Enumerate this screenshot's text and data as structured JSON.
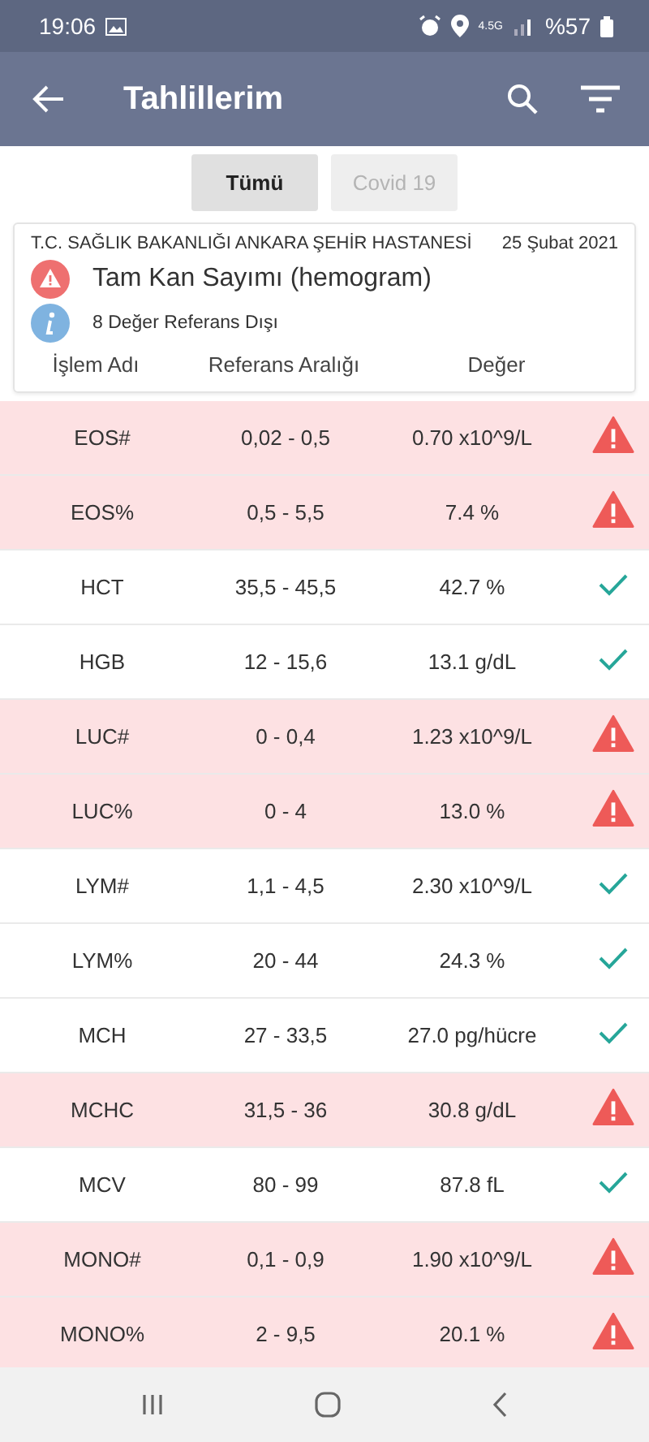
{
  "status_bar": {
    "time": "19:06",
    "network": "4.5G",
    "battery": "%57"
  },
  "app_bar": {
    "title": "Tahlillerim"
  },
  "tabs": [
    {
      "label": "Tümü",
      "selected": true
    },
    {
      "label": "Covid 19",
      "selected": false
    }
  ],
  "report": {
    "hospital": "T.C. SAĞLIK BAKANLIĞI ANKARA ŞEHİR HASTANESİ",
    "date": "25 Şubat 2021",
    "title": "Tam Kan Sayımı (hemogram)",
    "note": "8 Değer Referans Dışı",
    "columns": [
      "İşlem Adı",
      "Referans Aralığı",
      "Değer"
    ]
  },
  "rows": [
    {
      "name": "EOS#",
      "range": "0,02 - 0,5",
      "value": "0.70 x10^9/L",
      "abnormal": true
    },
    {
      "name": "EOS%",
      "range": "0,5 - 5,5",
      "value": "7.4 %",
      "abnormal": true
    },
    {
      "name": "HCT",
      "range": "35,5 - 45,5",
      "value": "42.7 %",
      "abnormal": false
    },
    {
      "name": "HGB",
      "range": "12 - 15,6",
      "value": "13.1 g/dL",
      "abnormal": false
    },
    {
      "name": "LUC#",
      "range": "0 - 0,4",
      "value": "1.23 x10^9/L",
      "abnormal": true
    },
    {
      "name": "LUC%",
      "range": "0 - 4",
      "value": "13.0 %",
      "abnormal": true
    },
    {
      "name": "LYM#",
      "range": "1,1 - 4,5",
      "value": "2.30 x10^9/L",
      "abnormal": false
    },
    {
      "name": "LYM%",
      "range": "20 - 44",
      "value": "24.3 %",
      "abnormal": false
    },
    {
      "name": "MCH",
      "range": "27 - 33,5",
      "value": "27.0 pg/hücre",
      "abnormal": false
    },
    {
      "name": "MCHC",
      "range": "31,5 - 36",
      "value": "30.8 g/dL",
      "abnormal": true
    },
    {
      "name": "MCV",
      "range": "80 - 99",
      "value": "87.8 fL",
      "abnormal": false
    },
    {
      "name": "MONO#",
      "range": "0,1 - 0,9",
      "value": "1.90 x10^9/L",
      "abnormal": true
    },
    {
      "name": "MONO%",
      "range": "2 - 9,5",
      "value": "20.1 %",
      "abnormal": true
    }
  ]
}
